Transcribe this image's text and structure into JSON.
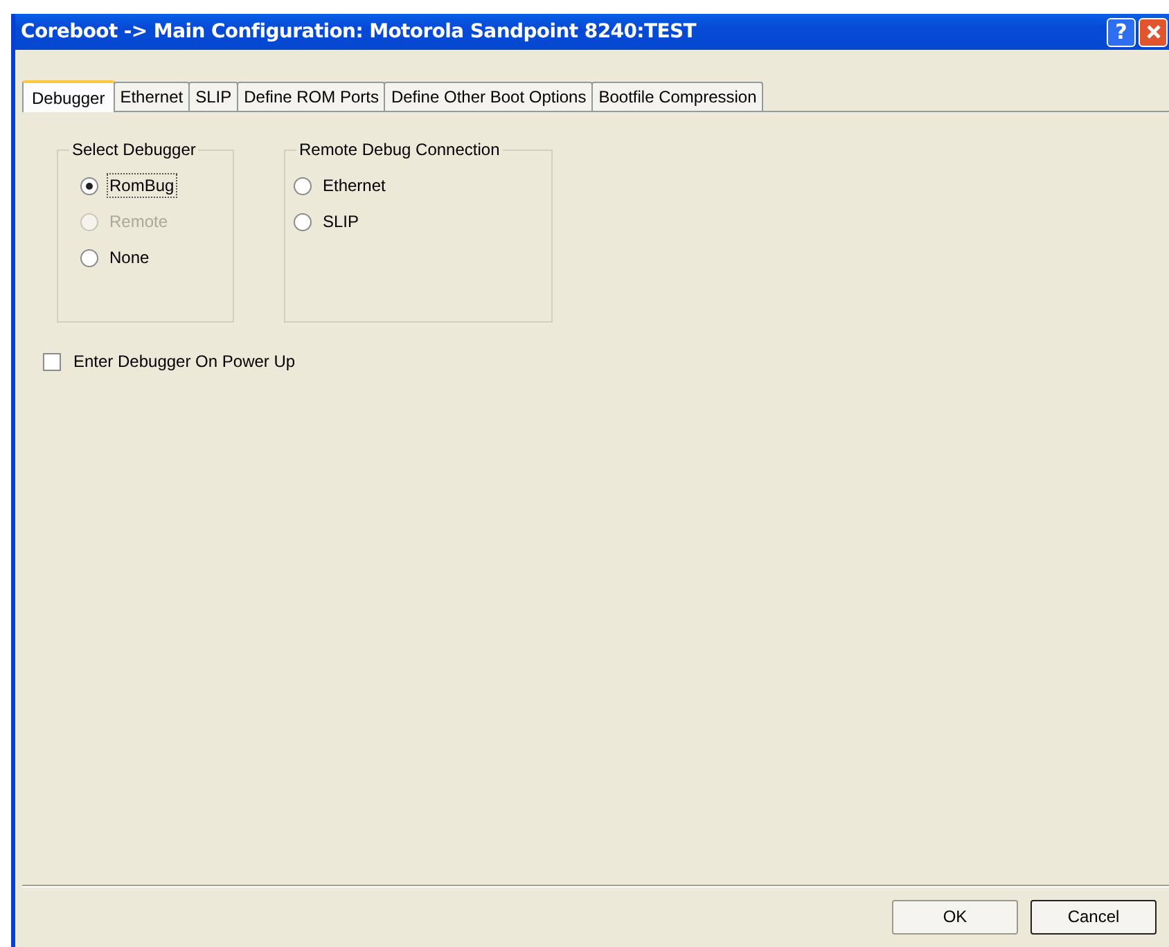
{
  "window": {
    "title": "Coreboot -> Main Configuration: Motorola Sandpoint 8240:TEST",
    "help_button": "?"
  },
  "tabs": [
    {
      "label": "Debugger",
      "selected": true
    },
    {
      "label": "Ethernet",
      "selected": false
    },
    {
      "label": "SLIP",
      "selected": false
    },
    {
      "label": "Define ROM Ports",
      "selected": false
    },
    {
      "label": "Define Other Boot Options",
      "selected": false
    },
    {
      "label": "Bootfile Compression",
      "selected": false
    }
  ],
  "groups": [
    {
      "title": "Select Debugger",
      "options": [
        {
          "label": "RomBug",
          "selected": true,
          "disabled": false,
          "focused": true
        },
        {
          "label": "Remote",
          "selected": false,
          "disabled": true,
          "focused": false
        },
        {
          "label": "None",
          "selected": false,
          "disabled": false,
          "focused": false
        }
      ]
    },
    {
      "title": "Remote Debug Connection",
      "options": [
        {
          "label": "Ethernet",
          "selected": false,
          "disabled": false,
          "focused": false
        },
        {
          "label": "SLIP",
          "selected": false,
          "disabled": false,
          "focused": false
        }
      ]
    }
  ],
  "checkbox": {
    "label": "Enter Debugger On Power Up",
    "checked": false
  },
  "buttons": [
    "OK",
    "Cancel"
  ]
}
